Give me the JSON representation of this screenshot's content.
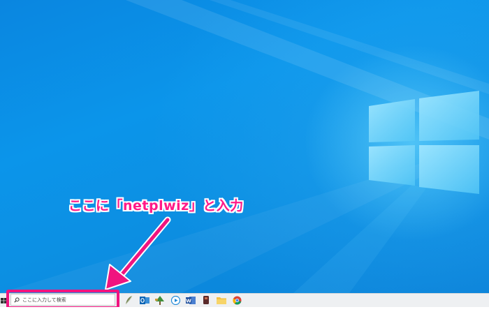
{
  "annotation": {
    "text": "ここに「netplwiz」と入力"
  },
  "taskbar": {
    "search_placeholder": "ここに入力して検索",
    "pinned_apps": [
      {
        "name": "feather-app-icon",
        "color": "#7a8a5a"
      },
      {
        "name": "outlook-icon",
        "color": "#0a64b4"
      },
      {
        "name": "tree-app-icon",
        "color": "#3f8f3a"
      },
      {
        "name": "media-player-icon",
        "color": "#1e88d8"
      },
      {
        "name": "word-icon",
        "color": "#1f4e9c"
      },
      {
        "name": "dark-app-icon",
        "color": "#5a2a2a"
      },
      {
        "name": "file-explorer-icon",
        "color": "#f2c043"
      },
      {
        "name": "chrome-icon",
        "color": "#db4437"
      }
    ]
  },
  "colors": {
    "highlight": "#f0147f",
    "annotation_text": "#ff1a88",
    "desktop_blue": "#0b95ea"
  }
}
